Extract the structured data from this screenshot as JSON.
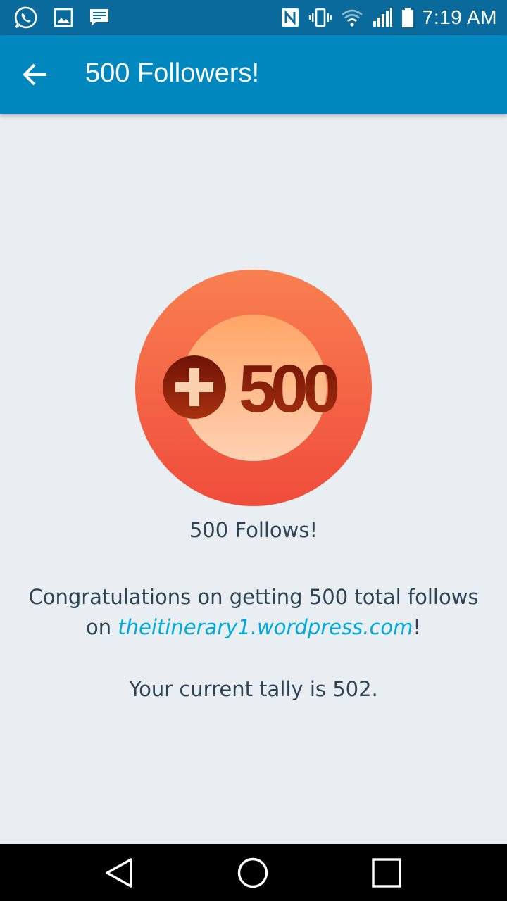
{
  "status_bar": {
    "time": "7:19 AM",
    "left_icons": [
      "whatsapp-icon",
      "image-icon",
      "message-icon"
    ],
    "right_icons": [
      "nfc-icon",
      "vibrate-icon",
      "wifi-icon",
      "signal-icon",
      "battery-icon"
    ]
  },
  "app_bar": {
    "title": "500 Followers!",
    "back_icon": "arrow-left-icon"
  },
  "badge": {
    "text": "500",
    "icon": "plus-circle-icon",
    "colors": {
      "outer_top": "#f97f50",
      "outer_bottom": "#ef4c3c",
      "inner_top": "#ffa566",
      "inner_bottom": "#ffd1b3",
      "text": "#8a1c0c"
    }
  },
  "badge_caption": "500 Follows!",
  "message": {
    "prefix": "Congratulations on getting 500 total follows on ",
    "link_text": "theitinerary1.wordpress.com",
    "suffix": "!"
  },
  "tally": "Your current tally is 502.",
  "nav_bar": {
    "buttons": [
      "back-triangle-icon",
      "home-circle-icon",
      "recents-square-icon"
    ]
  },
  "colors": {
    "status_bar": "#0b6a9c",
    "app_bar": "#0087be",
    "background": "#e9eef3",
    "text": "#2e4453",
    "link": "#00aadc"
  }
}
